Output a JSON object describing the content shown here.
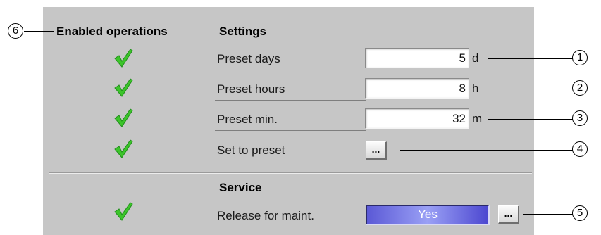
{
  "headers": {
    "enabled_operations": "Enabled operations",
    "settings": "Settings",
    "service": "Service"
  },
  "rows": [
    {
      "label": "Preset days",
      "value": "5",
      "unit": "d",
      "callout": "1"
    },
    {
      "label": "Preset hours",
      "value": "8",
      "unit": "h",
      "callout": "2"
    },
    {
      "label": "Preset min.",
      "value": "32",
      "unit": "m",
      "callout": "3"
    },
    {
      "label": "Set to preset",
      "button": "...",
      "callout": "4"
    }
  ],
  "service_row": {
    "label": "Release for maint.",
    "state": "Yes",
    "button": "...",
    "callout": "5"
  },
  "header_callout": "6",
  "icons": {
    "enabled": "green-checkmark-icon"
  },
  "colors": {
    "panel": "#c6c6c6",
    "check": "#3cc42a",
    "yes_button": "#5b59d6"
  }
}
